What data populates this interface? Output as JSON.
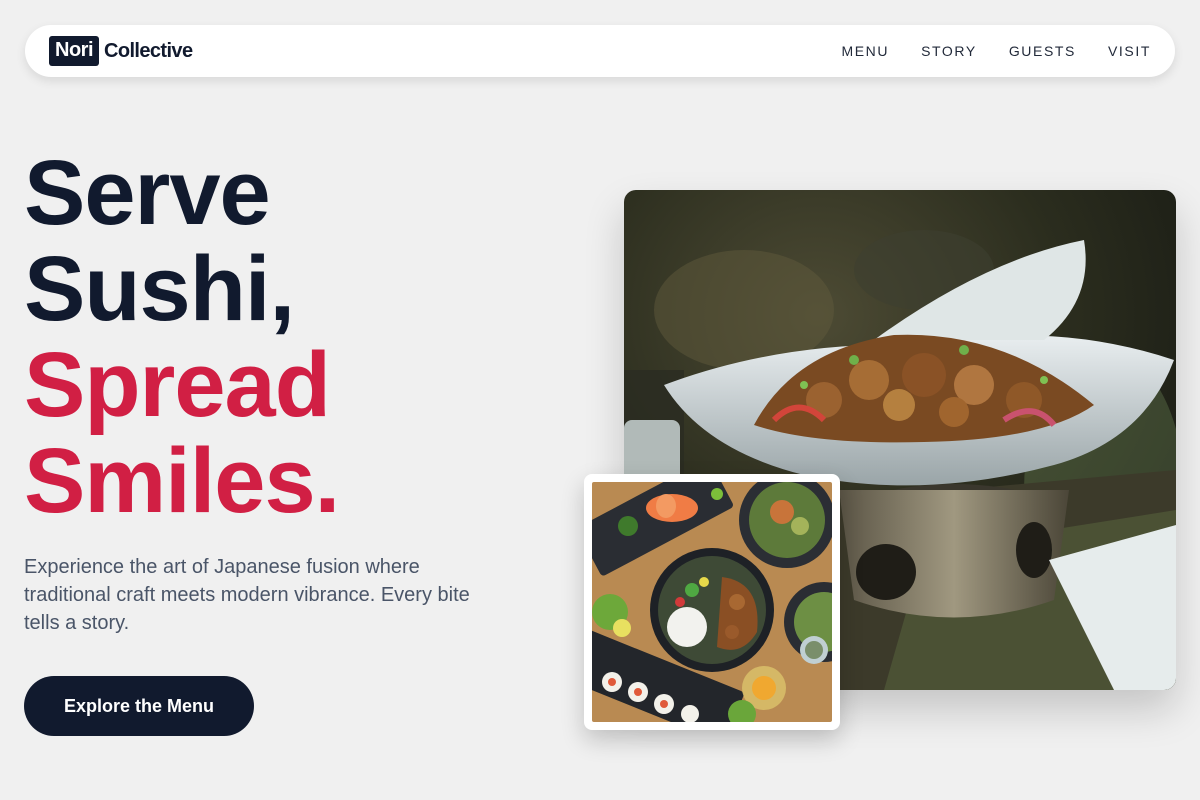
{
  "brand": {
    "box_text": "Nori",
    "name": "Collective"
  },
  "nav": {
    "items": [
      "MENU",
      "STORY",
      "GUESTS",
      "VISIT"
    ]
  },
  "hero": {
    "title_lines": [
      "Serve",
      "Sushi,",
      "Spread",
      "Smiles."
    ],
    "description": "Experience the art of Japanese fusion where traditional craft meets modern vibrance. Every bite tells a story.",
    "cta_label": "Explore the Menu"
  },
  "colors": {
    "navy": "#111a2e",
    "accent_red": "#d11f44",
    "background": "#f0f0f0",
    "muted_text": "#4a5568"
  },
  "images": {
    "main": "plated-fried-dish-photo",
    "thumb": "sushi-table-overhead-photo"
  }
}
